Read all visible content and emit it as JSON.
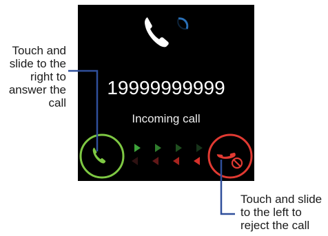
{
  "callouts": {
    "answer": "Touch and\nslide to the\nright to\nanswer the\ncall",
    "reject": "Touch and slide\nto the left to\nreject the call"
  },
  "screen": {
    "caller_number": "19999999999",
    "call_status": "Incoming call",
    "top_icon": "phone-handset-icon",
    "accept_icon": "phone-accept-icon",
    "reject_icon": "phone-reject-icon"
  },
  "colors": {
    "screen_background": "#000000",
    "accept": "#7ec843",
    "reject": "#e13a32",
    "leader_line": "#2f4f9b",
    "arrow_right": "#3da33a",
    "arrow_left": "#d8312b"
  }
}
